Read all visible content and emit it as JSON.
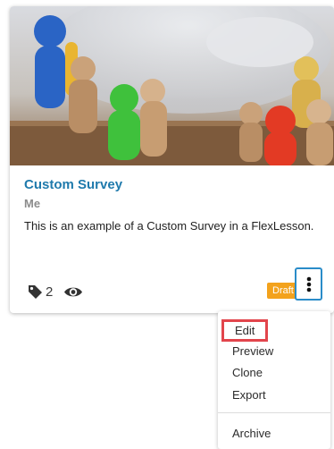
{
  "card": {
    "title": "Custom Survey",
    "author": "Me",
    "description": "This is an example of a Custom Survey in a FlexLesson.",
    "tag_count": "2",
    "status": "Draft",
    "image_icon": "wooden-figures-photo"
  },
  "icons": {
    "tag": "tag-icon",
    "views": "eye-icon",
    "more": "vertical-ellipsis-icon"
  },
  "menu": {
    "items": [
      {
        "label": "Edit",
        "highlighted": true
      },
      {
        "label": "Preview"
      },
      {
        "label": "Clone"
      },
      {
        "label": "Export"
      },
      {
        "label": "Archive"
      }
    ]
  },
  "colors": {
    "title": "#1f7aac",
    "badge": "#f3a21c",
    "button_border": "#2a8cc9",
    "highlight": "#e2454c"
  }
}
